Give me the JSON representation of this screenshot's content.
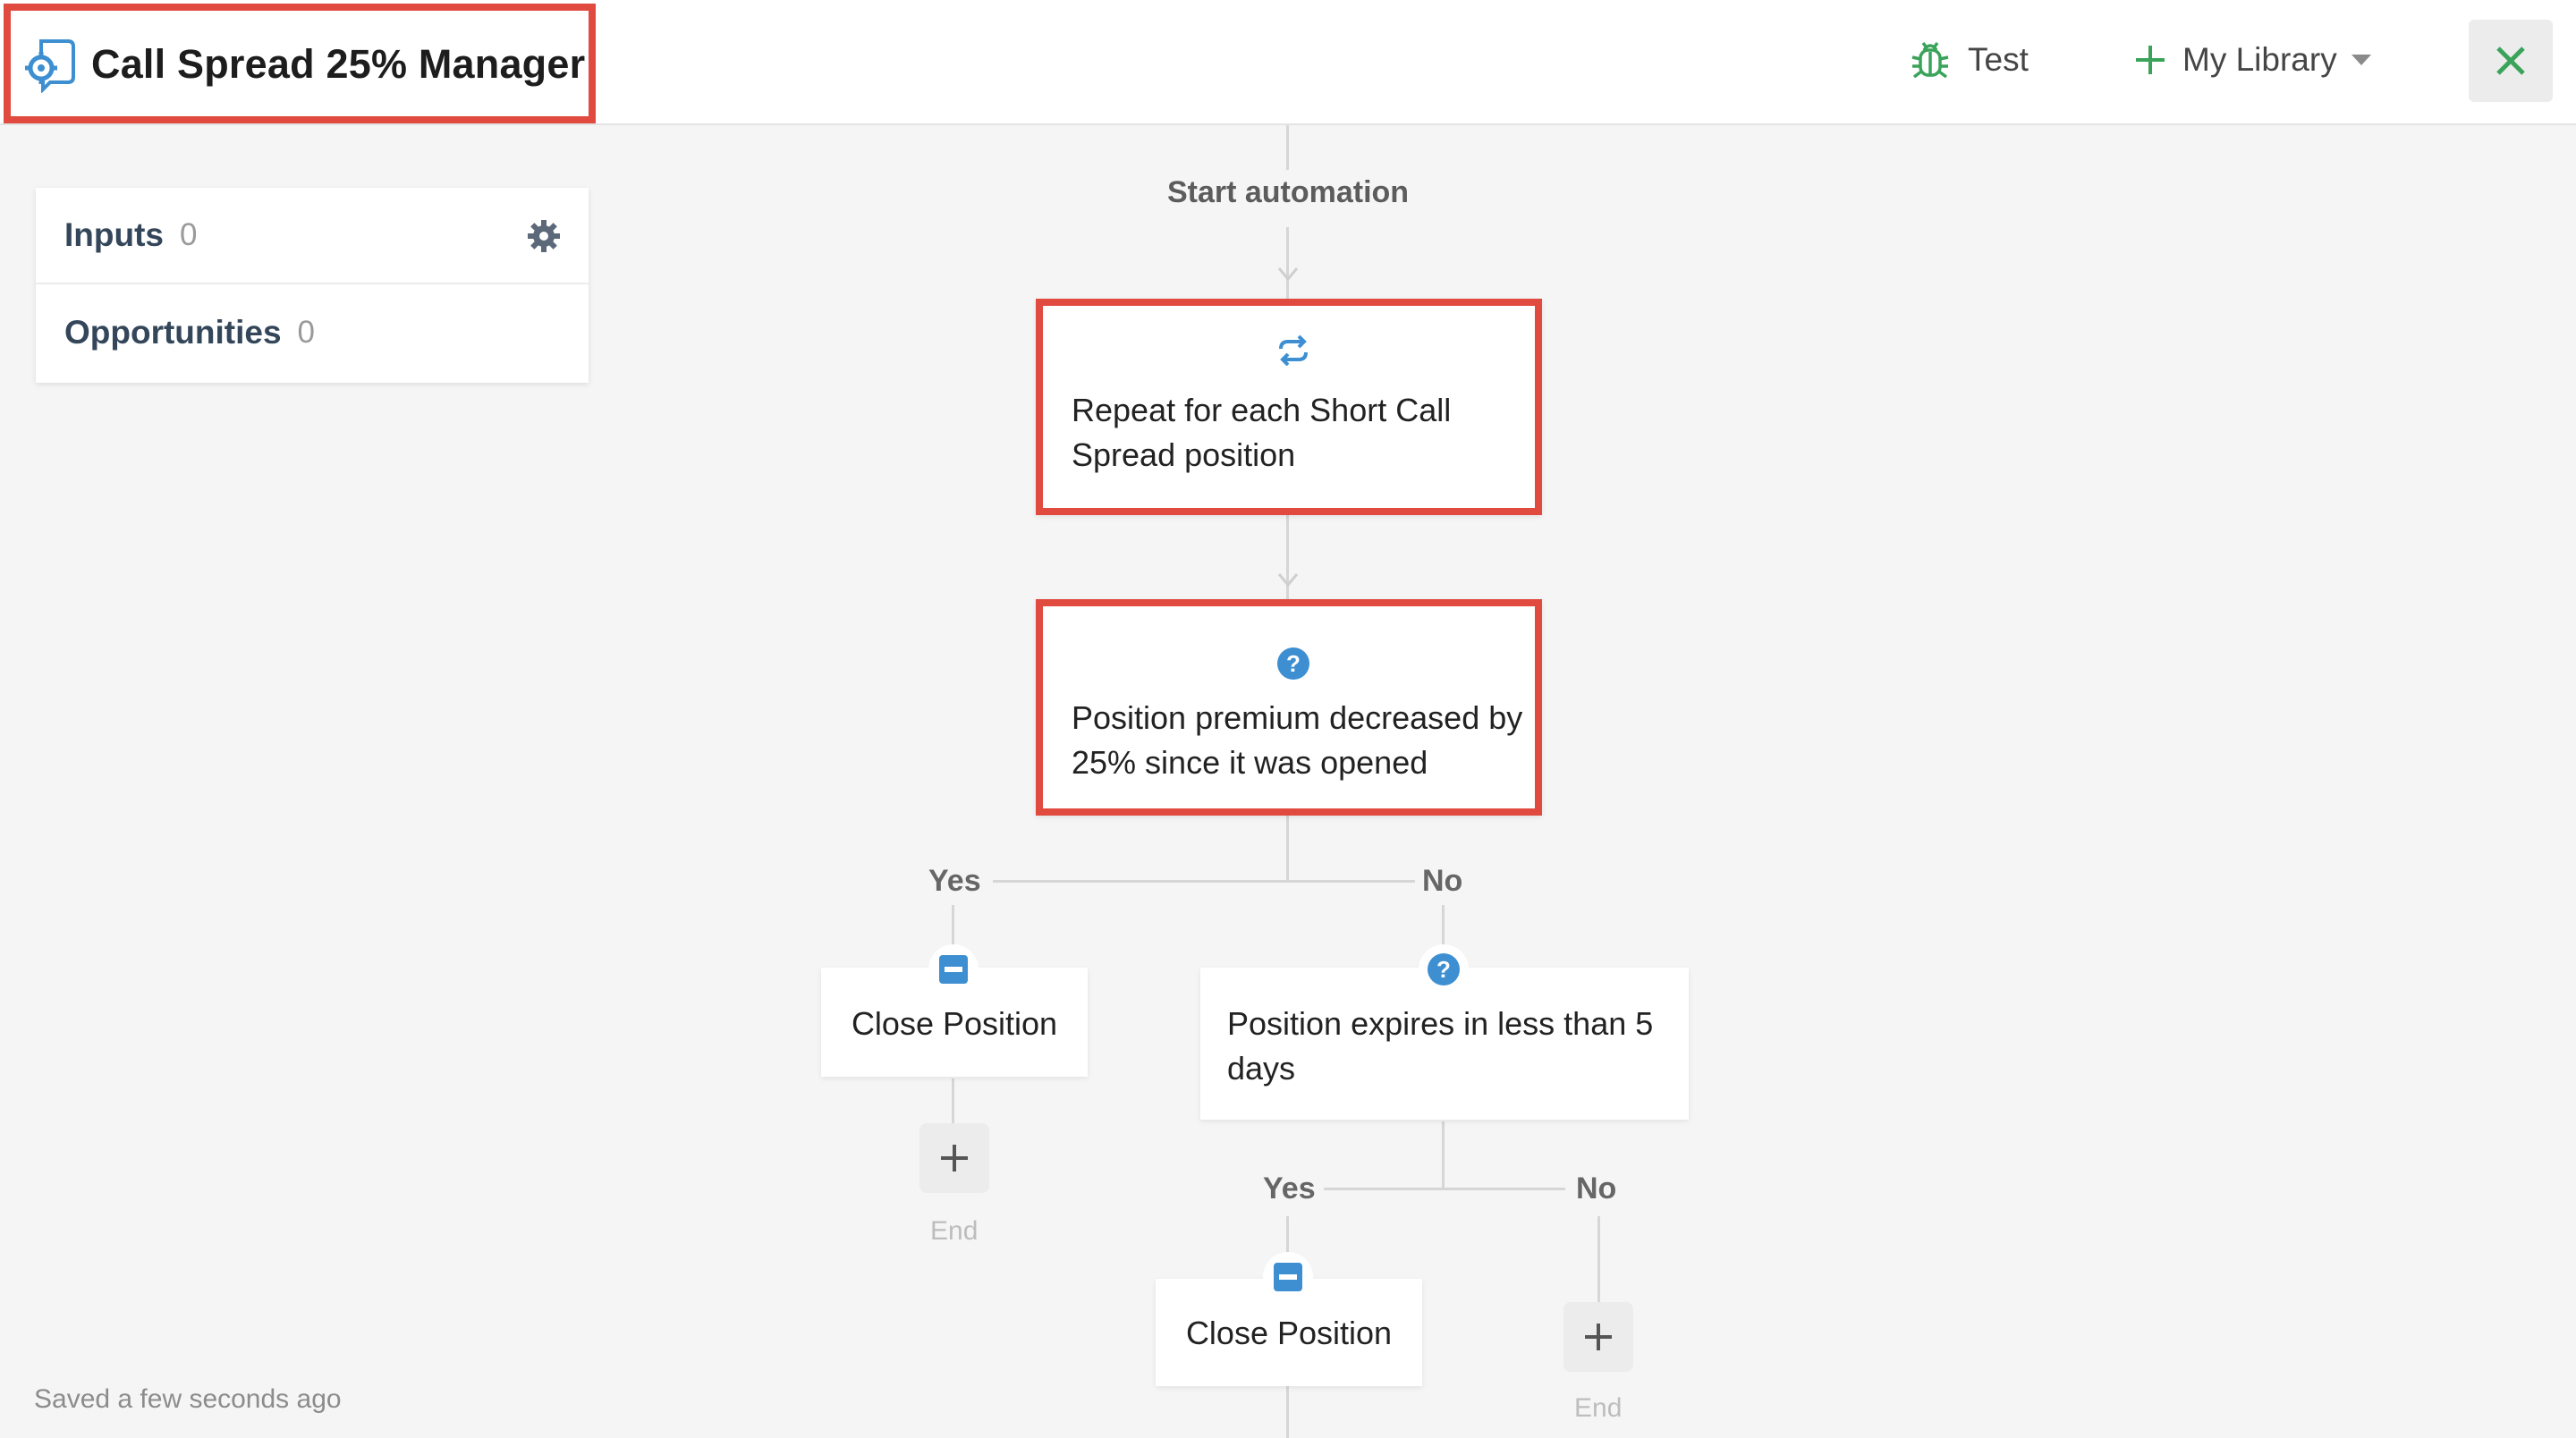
{
  "header": {
    "title": "Call Spread 25% Manager",
    "test_label": "Test",
    "library_label": "My Library"
  },
  "side_panel": {
    "inputs": {
      "label": "Inputs",
      "count": "0"
    },
    "opportunities": {
      "label": "Opportunities",
      "count": "0"
    }
  },
  "flow": {
    "start_label": "Start automation",
    "repeat_node": "Repeat for each Short Call Spread position",
    "condition_1": "Position premium decreased by 25% since it was opened",
    "branch_yes_1": "Yes",
    "branch_no_1": "No",
    "close_position_1": "Close Position",
    "end_1": "End",
    "condition_2": "Position expires in less than 5 days",
    "branch_yes_2": "Yes",
    "branch_no_2": "No",
    "close_position_2": "Close Position",
    "end_2": "End"
  },
  "status": {
    "saved": "Saved a few seconds ago"
  },
  "colors": {
    "highlight": "#e04a3f",
    "accent_green": "#3aa35a",
    "icon_blue": "#3d8fd1",
    "panel_text": "#34465a"
  },
  "icons": {
    "app": "automation-gear-icon",
    "test": "bug-icon",
    "library": "plus-icon",
    "close": "close-icon",
    "settings": "gear-icon",
    "repeat": "repeat-icon",
    "condition": "question-icon",
    "action": "minus-icon",
    "add": "plus-icon"
  }
}
